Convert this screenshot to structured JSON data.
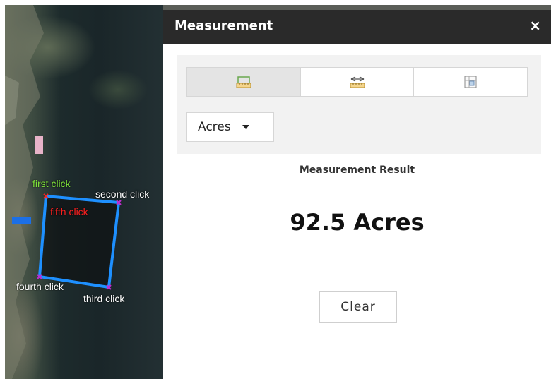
{
  "panel": {
    "title": "Measurement",
    "close_icon": "×",
    "tools": [
      {
        "name": "area-tool-icon",
        "active": true
      },
      {
        "name": "distance-tool-icon",
        "active": false
      },
      {
        "name": "location-tool-icon",
        "active": false
      }
    ],
    "unit": {
      "selected": "Acres"
    },
    "result_label": "Measurement Result",
    "result_value": "92.5 Acres",
    "clear_label": "Clear"
  },
  "map": {
    "labels": {
      "first": "first click",
      "second": "second click",
      "third": "third click",
      "fourth": "fourth click",
      "fifth": "fifth click"
    },
    "colors": {
      "polygon_stroke": "#1e90ff",
      "first_label": "#7ee03a",
      "fifth_label": "#ff2020",
      "other_labels": "#ffffff"
    }
  }
}
